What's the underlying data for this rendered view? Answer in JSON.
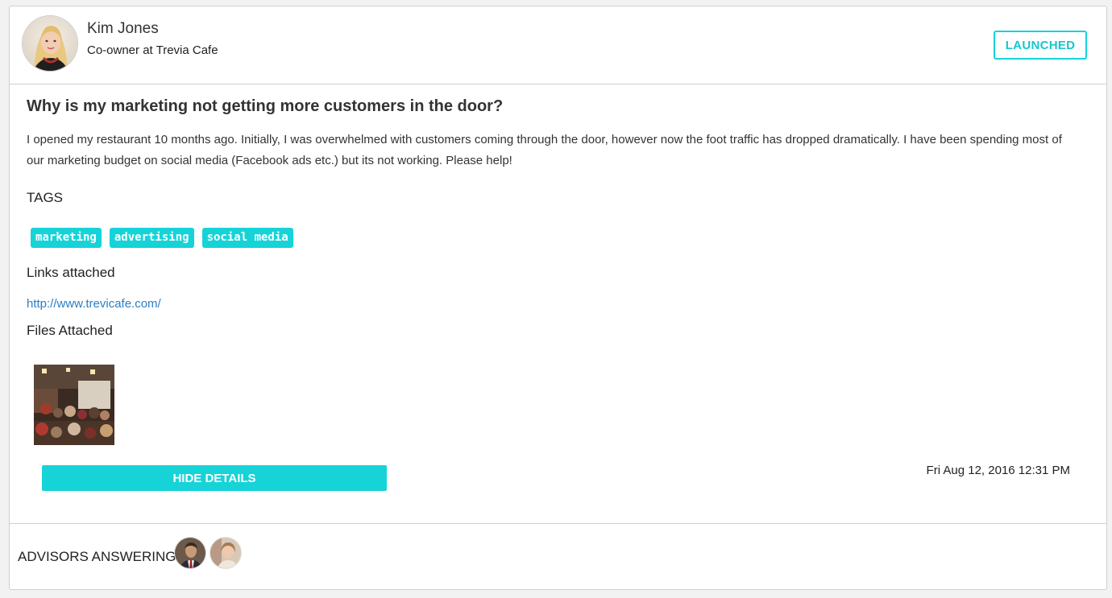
{
  "user": {
    "name": "Kim Jones",
    "role": "Co-owner at Trevia Cafe",
    "avatar_icon": "user-avatar-photo"
  },
  "status": {
    "label": "LAUNCHED",
    "color": "#16d3d8"
  },
  "question": {
    "title": "Why is my marketing not getting more customers in the door?",
    "body": "I opened my restaurant 10 months ago. Initially, I was overwhelmed with customers coming through the door, however now the foot traffic has dropped dramatically. I have been spending most of our marketing budget on social media (Facebook ads etc.) but its not working. Please help!"
  },
  "tags": {
    "label": "TAGS",
    "items": [
      "marketing",
      "advertising",
      "social media"
    ]
  },
  "links": {
    "label": "Links attached",
    "items": [
      "http://www.trevicafe.com/"
    ]
  },
  "files": {
    "label": "Files Attached",
    "thumbnail_icon": "restaurant-photo-thumbnail"
  },
  "actions": {
    "hide_details_label": "HIDE DETAILS"
  },
  "timestamp": "Fri Aug 12, 2016 12:31 PM",
  "advisors": {
    "label": "ADVISORS ANSWERING:",
    "avatars": [
      "advisor-avatar-1",
      "advisor-avatar-2"
    ]
  },
  "colors": {
    "accent": "#16d3d8",
    "link": "#2a7fc4",
    "border": "#cfcfcf"
  }
}
